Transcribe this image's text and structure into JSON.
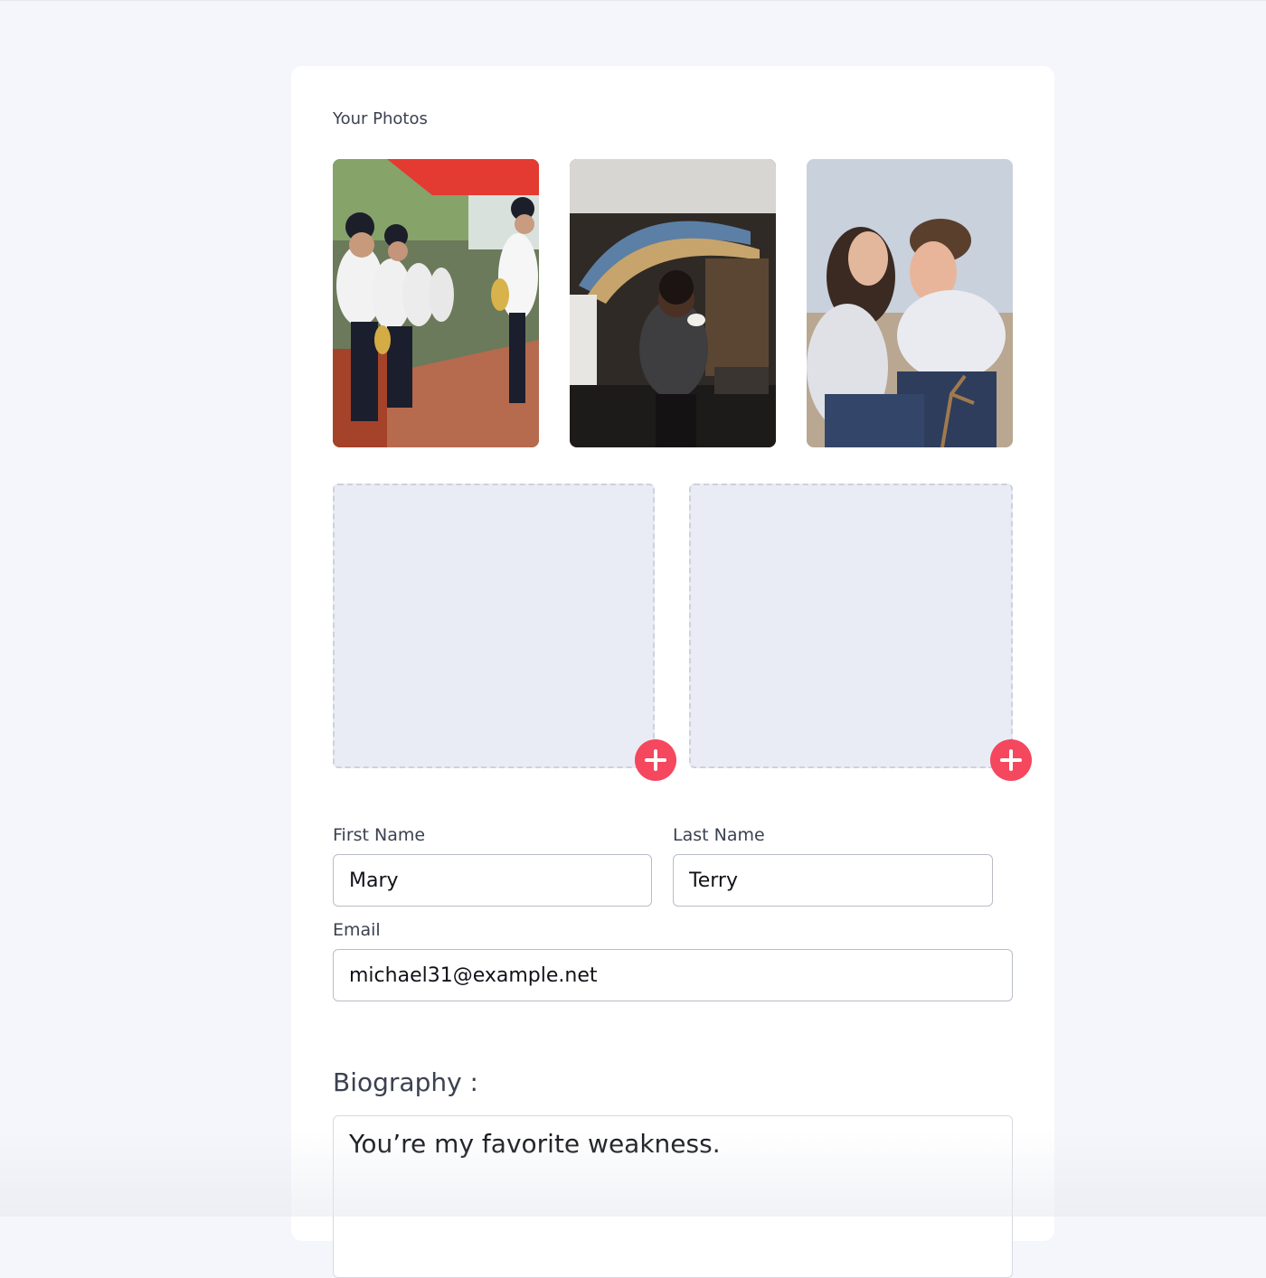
{
  "photos_section": {
    "title": "Your Photos"
  },
  "form": {
    "first_name_label": "First Name",
    "first_name_value": "Mary",
    "last_name_label": "Last Name",
    "last_name_value": "Terry",
    "email_label": "Email",
    "email_value": "michael31@example.net"
  },
  "biography": {
    "title": "Biography :",
    "text": "You’re my favorite weakness."
  },
  "colors": {
    "accent": "#f5475d",
    "page_background": "#f5f6fc",
    "slot_background": "#e9ecf5"
  },
  "icons": [
    "plus-icon"
  ]
}
